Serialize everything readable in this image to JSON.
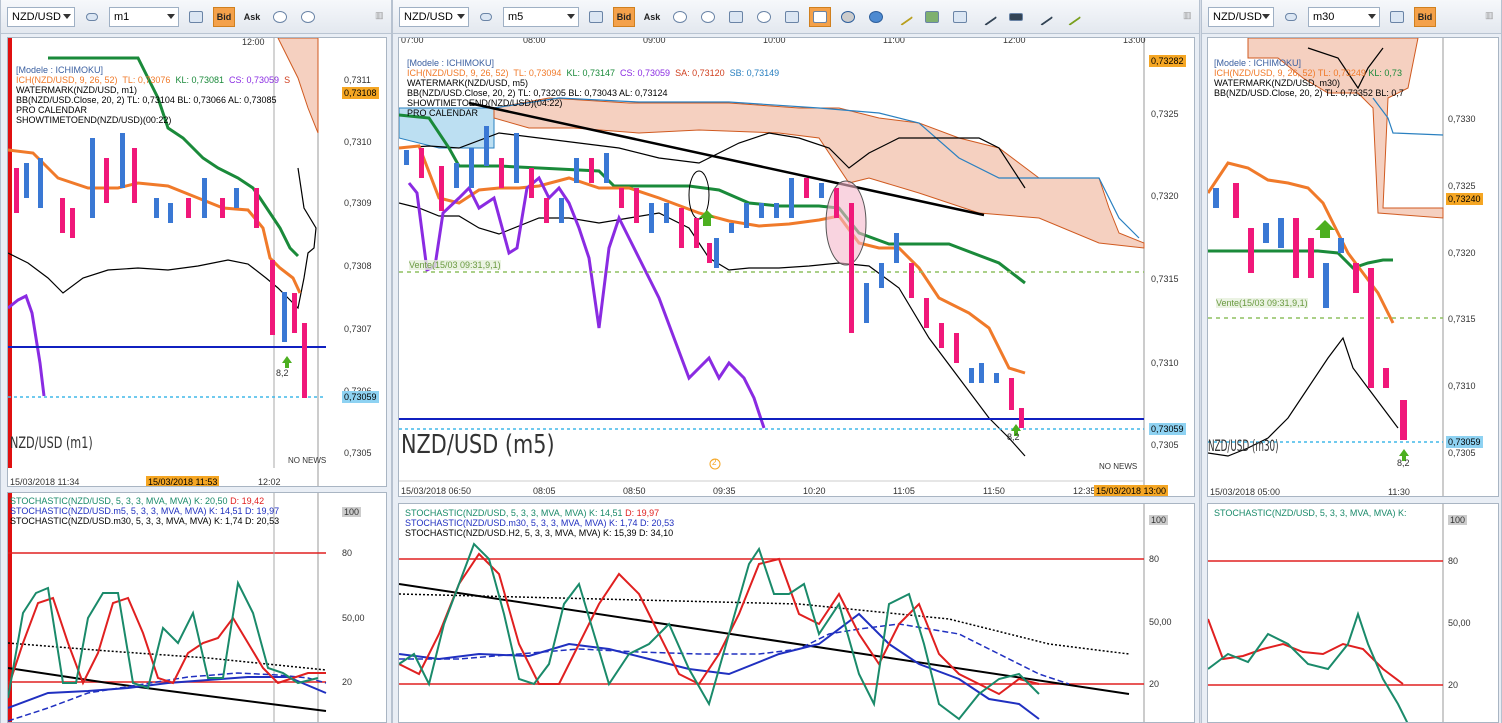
{
  "panels": [
    {
      "id": "m1",
      "symbol": "NZD/USD",
      "timeframe": "m1",
      "legend": [
        {
          "text": "[Modele : ICHIMOKU]",
          "color": "#3a5fa0"
        },
        {
          "text": "ICH(NZD/USD, 9, 26, 52)",
          "color": "#f07a2a"
        },
        {
          "text": "WATERMARK(NZD/USD, m1)",
          "color": "#000000"
        },
        {
          "text": "BB(NZD/USD.Close, 20, 2)  TL: 0,73104   BL: 0,73066   AL: 0,73085",
          "color": "#000000"
        },
        {
          "text": "PRO CALENDAR",
          "color": "#000000"
        },
        {
          "text": "SHOWTIMETOEND(NZD/USD)(00:22)",
          "color": "#000000"
        }
      ],
      "ich_values": [
        {
          "text": "TL: 0,73076",
          "color": "#f07a2a"
        },
        {
          "text": "KL: 0,73081",
          "color": "#1a8a3a"
        },
        {
          "text": "CS: 0,73059",
          "color": "#8a2be2"
        },
        {
          "text": "S",
          "color": "#d04020"
        }
      ],
      "y_ticks": [
        "0,7311",
        "0,7310",
        "0,7309",
        "0,7308",
        "0,7307",
        "0,7306",
        "0,7305"
      ],
      "price_tag_top": "0,73108",
      "price_tag_current": "0,73059",
      "time_top": "12:00",
      "time_bottom": [
        "15/03/2018 11:34",
        "15/03/2018 11:53",
        "12:02"
      ],
      "watermark": "NZD/USD (m1)",
      "arrow_value": "8,2",
      "no_news": "NO NEWS",
      "stoch_legend": [
        {
          "text": "STOCHASTIC(NZD/USD, 5, 3, 3, MVA, MVA)  K: 20,50",
          "color": "#1a8a6a"
        },
        {
          "text": "D: 19,42",
          "color": "#e02020"
        },
        {
          "text": "STOCHASTIC(NZD/USD.m5, 5, 3, 3, MVA, MVA)  K: 14,51  D: 19,97",
          "color": "#2030c0"
        },
        {
          "text": "STOCHASTIC(NZD/USD.m30, 5, 3, 3, MVA, MVA)  K: 1,74  D: 20,53",
          "color": "#000000"
        }
      ],
      "stoch_ticks": [
        "100",
        "80",
        "50,00",
        "20"
      ]
    },
    {
      "id": "m5",
      "symbol": "NZD/USD",
      "timeframe": "m5",
      "legend": [
        {
          "text": "[Modele : ICHIMOKU]",
          "color": "#3a5fa0"
        },
        {
          "text": "ICH(NZD/USD, 9, 26, 52)",
          "color": "#f07a2a"
        },
        {
          "text": "WATERMARK(NZD/USD, m5)",
          "color": "#000000"
        },
        {
          "text": "BB(NZD/USD.Close, 20, 2)  TL: 0,73205   BL: 0,73043   AL: 0,73124",
          "color": "#000000"
        },
        {
          "text": "SHOWTIMETOEND(NZD/USD)(04:22)",
          "color": "#000000"
        },
        {
          "text": "PRO CALENDAR",
          "color": "#000000"
        }
      ],
      "ich_values": [
        {
          "text": "TL: 0,73094",
          "color": "#f07a2a"
        },
        {
          "text": "KL: 0,73147",
          "color": "#1a8a3a"
        },
        {
          "text": "CS: 0,73059",
          "color": "#8a2be2"
        },
        {
          "text": "SA: 0,73120",
          "color": "#d04020"
        },
        {
          "text": "SB: 0,73149",
          "color": "#2a80c0"
        }
      ],
      "y_ticks": [
        "0,7325",
        "0,7320",
        "0,7315",
        "0,7310",
        "0,7305"
      ],
      "price_tag_top": "0,73282",
      "price_tag_current": "0,73059",
      "time_top": [
        "07:00",
        "08:00",
        "09:00",
        "10:00",
        "11:00",
        "12:00",
        "13:00"
      ],
      "time_bottom": [
        "15/03/2018 06:50",
        "08:05",
        "08:50",
        "09:35",
        "10:20",
        "11:05",
        "11:50",
        "12:35"
      ],
      "time_bottom_tag": "15/03/2018 13:00",
      "watermark": "NZD/USD (m5)",
      "arrow_value": "8,2",
      "no_news": "NO NEWS",
      "vente_label": "Vente(15/03 09:31,9,1)",
      "calendar_marker": "2",
      "stoch_legend": [
        {
          "text": "STOCHASTIC(NZD/USD, 5, 3, 3, MVA, MVA)  K: 14,51",
          "color": "#1a8a6a"
        },
        {
          "text": "D: 19,97",
          "color": "#e02020"
        },
        {
          "text": "STOCHASTIC(NZD/USD.m30, 5, 3, 3, MVA, MVA)  K: 1,74  D: 20,53",
          "color": "#2030c0"
        },
        {
          "text": "STOCHASTIC(NZD/USD.H2, 5, 3, 3, MVA, MVA)  K: 15,39  D: 34,10",
          "color": "#000000"
        }
      ],
      "stoch_ticks": [
        "100",
        "80",
        "50,00",
        "20"
      ]
    },
    {
      "id": "m30",
      "symbol": "NZD/USD",
      "timeframe": "m30",
      "legend": [
        {
          "text": "[Modele : ICHIMOKU]",
          "color": "#3a5fa0"
        },
        {
          "text": "ICH(NZD/USD, 9, 26, 52)  TL: 0,73249",
          "color": "#f07a2a"
        },
        {
          "text": "WATERMARK(NZD/USD, m30)",
          "color": "#000000"
        },
        {
          "text": "BB(NZD/USD.Close, 20, 2)  TL: 0,73352   BL: 0,7",
          "color": "#000000"
        }
      ],
      "ich_values": [
        {
          "text": "KL: 0,73",
          "color": "#1a8a3a"
        }
      ],
      "y_ticks": [
        "0,7330",
        "0,7325",
        "0,7320",
        "0,7315",
        "0,7310",
        "0,7305"
      ],
      "price_tag_top": "0,73240",
      "price_tag_current": "0,73059",
      "time_bottom": [
        "15/03/2018 05:00",
        "11:30"
      ],
      "watermark": "NZD/USD (m30)",
      "arrow_value": "8,2",
      "vente_label": "Vente(15/03 09:31,9,1)",
      "stoch_legend": [
        {
          "text": "STOCHASTIC(NZD/USD, 5, 3, 3, MVA, MVA)  K:",
          "color": "#1a8a6a"
        }
      ],
      "stoch_ticks": [
        "100",
        "80",
        "50,00",
        "20"
      ]
    }
  ],
  "toolbar": {
    "bid_label": "Bid",
    "ask_label": "Ask"
  },
  "colors": {
    "candle_up": "#3a78d4",
    "candle_down": "#f0187a",
    "tenkan": "#f07a2a",
    "kijun": "#1a8a3a",
    "chikou": "#8a2be2",
    "cloud_fill": "#f5d0c0",
    "cloud_fill_blue": "#bcdff2",
    "price_line": "#1020c0",
    "current_line": "#40b8e8",
    "stoch_k": "#1a8a6a",
    "stoch_d": "#e02020",
    "accent_orange": "#f5a623"
  }
}
